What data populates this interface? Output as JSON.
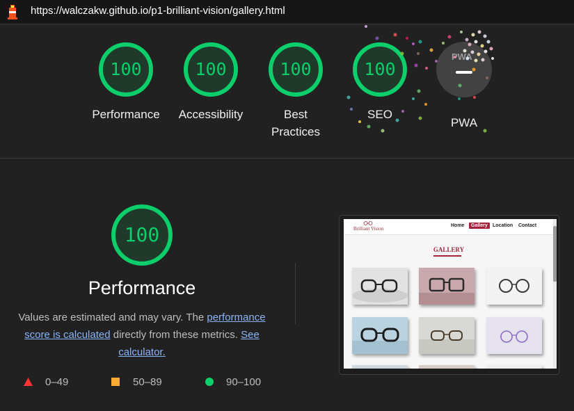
{
  "url": "https://walczakw.github.io/p1-brilliant-vision/gallery.html",
  "scores": [
    {
      "label": "Performance",
      "score": "100"
    },
    {
      "label": "Accessibility",
      "score": "100"
    },
    {
      "label": "Best Practices",
      "score": "100"
    },
    {
      "label": "SEO",
      "score": "100"
    }
  ],
  "pwa": {
    "label": "PWA",
    "badge": "PWA"
  },
  "performance": {
    "score": "100",
    "title": "Performance",
    "desc_prefix": "Values are estimated and may vary. The ",
    "desc_link1": "performance score is calculated",
    "desc_middle": " directly from these metrics. ",
    "desc_link2": "See calculator."
  },
  "legend": [
    {
      "range": "0–49",
      "color": "#ff3333"
    },
    {
      "range": "50–89",
      "color": "#ffaa33"
    },
    {
      "range": "90–100",
      "color": "#0cce6b"
    }
  ],
  "screenshot": {
    "brand": "Brilliant Vision",
    "nav": [
      "Home",
      "Gallery",
      "Location",
      "Contact"
    ],
    "active_nav": "Gallery",
    "gallery_title": "GALLERY"
  },
  "colors": {
    "pass": "#0cce6b",
    "pass_fill": "#1f3a2b",
    "accent": "#a3243a"
  }
}
